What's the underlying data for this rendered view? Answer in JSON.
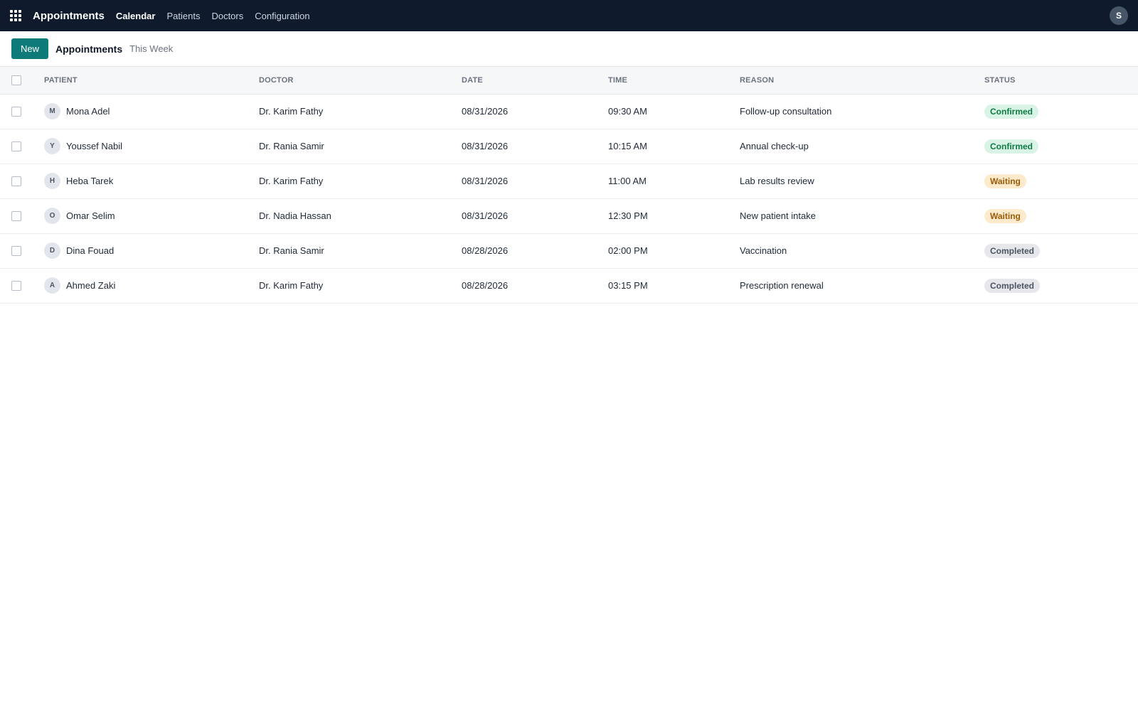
{
  "topbar": {
    "app_title": "Appointments",
    "nav": [
      "Calendar",
      "Patients",
      "Doctors",
      "Configuration"
    ],
    "active_nav": "Calendar",
    "user_initial": "S"
  },
  "controls": {
    "new_label": "New",
    "breadcrumb": "Appointments",
    "filter": "This Week"
  },
  "table": {
    "headers": [
      "PATIENT",
      "DOCTOR",
      "DATE",
      "TIME",
      "REASON",
      "STATUS"
    ],
    "rows": [
      {
        "initial": "M",
        "patient": "Mona Adel",
        "doctor": "Dr. Karim Fathy",
        "date": "08/31/2026",
        "time": "09:30 AM",
        "reason": "Follow-up consultation",
        "status": "Confirmed",
        "status_kind": "confirmed"
      },
      {
        "initial": "Y",
        "patient": "Youssef Nabil",
        "doctor": "Dr. Rania Samir",
        "date": "08/31/2026",
        "time": "10:15 AM",
        "reason": "Annual check-up",
        "status": "Confirmed",
        "status_kind": "confirmed"
      },
      {
        "initial": "H",
        "patient": "Heba Tarek",
        "doctor": "Dr. Karim Fathy",
        "date": "08/31/2026",
        "time": "11:00 AM",
        "reason": "Lab results review",
        "status": "Waiting",
        "status_kind": "waiting"
      },
      {
        "initial": "O",
        "patient": "Omar Selim",
        "doctor": "Dr. Nadia Hassan",
        "date": "08/31/2026",
        "time": "12:30 PM",
        "reason": "New patient intake",
        "status": "Waiting",
        "status_kind": "waiting"
      },
      {
        "initial": "D",
        "patient": "Dina Fouad",
        "doctor": "Dr. Rania Samir",
        "date": "08/28/2026",
        "time": "02:00 PM",
        "reason": "Vaccination",
        "status": "Completed",
        "status_kind": "completed"
      },
      {
        "initial": "A",
        "patient": "Ahmed Zaki",
        "doctor": "Dr. Karim Fathy",
        "date": "08/28/2026",
        "time": "03:15 PM",
        "reason": "Prescription renewal",
        "status": "Completed",
        "status_kind": "completed"
      }
    ]
  },
  "colors": {
    "topbar_bg": "#0f1b2d",
    "accent": "#0f7b78",
    "confirmed": "#0f7a44",
    "waiting": "#9a5b06",
    "completed": "#4b5563"
  }
}
